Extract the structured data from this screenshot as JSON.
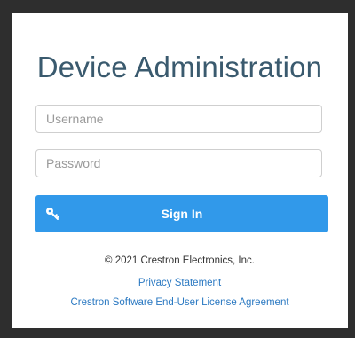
{
  "login": {
    "title": "Device Administration",
    "username_placeholder": "Username",
    "password_placeholder": "Password",
    "signin_label": "Sign In"
  },
  "footer": {
    "copyright": "© 2021 Crestron Electronics, Inc.",
    "privacy_link": "Privacy Statement",
    "eula_link": "Crestron Software End-User License Agreement"
  },
  "icons": {
    "signin_icon": "key-icon"
  },
  "colors": {
    "primary_button": "#3199ea",
    "title": "#3a5a6e",
    "link": "#2b79c2",
    "frame": "#2e2e2e"
  }
}
